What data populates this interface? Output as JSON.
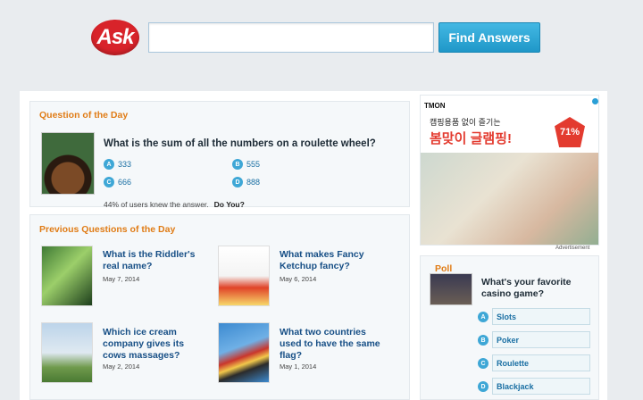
{
  "header": {
    "logo_text": "Ask",
    "search_placeholder": "",
    "search_value": "",
    "search_button": "Find Answers"
  },
  "qotd": {
    "title": "Question of the Day",
    "question": "What is the sum of all the numbers on a roulette wheel?",
    "answers": [
      {
        "letter": "A",
        "text": "333"
      },
      {
        "letter": "B",
        "text": "555"
      },
      {
        "letter": "C",
        "text": "666"
      },
      {
        "letter": "D",
        "text": "888"
      }
    ],
    "stat": "44% of users knew the answer.",
    "cta": "Do You?"
  },
  "previous": {
    "title": "Previous Questions of the Day",
    "items": [
      {
        "title_line1": "What is the Riddler's",
        "title_line2": "real name?",
        "title_line3": "",
        "date": "May 7, 2014",
        "icon": "riddler-image"
      },
      {
        "title_line1": "What makes Fancy",
        "title_line2": "Ketchup fancy?",
        "title_line3": "",
        "date": "May 6, 2014",
        "icon": "ketchup-image"
      },
      {
        "title_line1": "Which ice cream",
        "title_line2": "company gives its",
        "title_line3": "cows massages?",
        "date": "May 2, 2014",
        "icon": "cow-image"
      },
      {
        "title_line1": "What two countries",
        "title_line2": "used to have the same",
        "title_line3": "flag?",
        "date": "May 1, 2014",
        "icon": "flags-image"
      }
    ]
  },
  "ad": {
    "brand": "TMON",
    "subtitle": "캠핑용품 없이 즐기는",
    "headline": "봄맞이 글램핑!",
    "percent": "71%",
    "label": "Advertisement"
  },
  "poll": {
    "title": "Poll",
    "question": "What's your favorite casino game?",
    "options": [
      {
        "letter": "A",
        "text": "Slots"
      },
      {
        "letter": "B",
        "text": "Poker"
      },
      {
        "letter": "C",
        "text": "Roulette"
      },
      {
        "letter": "D",
        "text": "Blackjack"
      }
    ]
  },
  "colors": {
    "accent_orange": "#e07c16",
    "link_blue": "#174f86",
    "button_blue": "#2aa5d6",
    "logo_red": "#d8232a"
  }
}
